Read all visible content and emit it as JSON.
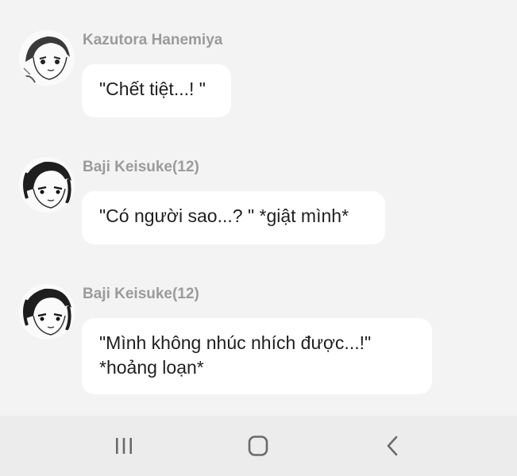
{
  "messages": [
    {
      "sender": "Kazutora Hanemiya",
      "avatar_icon": "manga-character-avatar",
      "lines": [
        "\"Chết tiệt...! \""
      ]
    },
    {
      "sender": "Baji Keisuke(12)",
      "avatar_icon": "manga-character-avatar",
      "lines": [
        "\"Có người sao...? \" *giật mình*"
      ]
    },
    {
      "sender": "Baji Keisuke(12)",
      "avatar_icon": "manga-character-avatar",
      "lines": [
        "\"Mình không nhúc nhích được...!\"",
        "*hoảng loạn*"
      ]
    }
  ],
  "navbar": {
    "recents_icon": "recent-apps-icon",
    "home_icon": "home-icon",
    "back_icon": "back-icon"
  },
  "colors": {
    "background": "#f3f3f3",
    "bubble": "#ffffff",
    "sender_text": "#9b9b9b",
    "message_text": "#1f1f1f",
    "navbar": "#ececec"
  }
}
